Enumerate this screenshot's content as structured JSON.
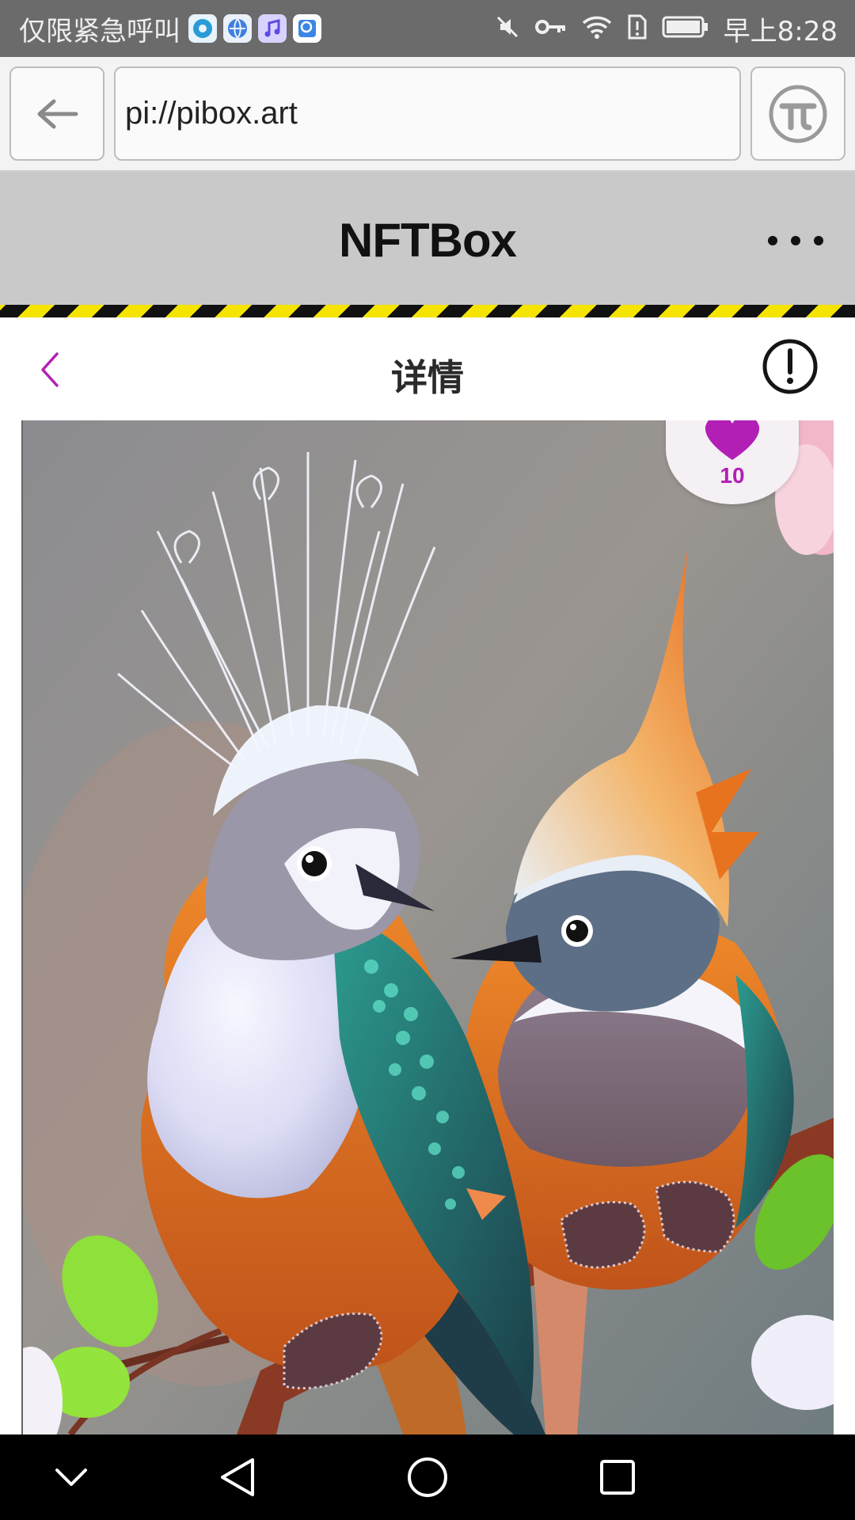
{
  "status_bar": {
    "carrier_text": "仅限紧急呼叫",
    "time": "早上8:28",
    "notification_icons": [
      "browser-app-icon",
      "globe-app-icon",
      "music-app-icon",
      "search-app-icon"
    ],
    "system_icons": [
      "mute-icon",
      "key-icon",
      "wifi-icon",
      "sim-alert-icon",
      "battery-icon"
    ]
  },
  "browser": {
    "url": "pi://pibox.art",
    "back_icon": "arrow-left-icon",
    "pi_icon": "pi-logo-icon"
  },
  "app_header": {
    "title": "NFTBox",
    "menu_icon": "more-dots-icon"
  },
  "detail": {
    "title": "详情",
    "back_icon": "chevron-left-icon",
    "info_icon": "info-circle-icon"
  },
  "artwork": {
    "likes": "10",
    "like_icon": "heart-icon"
  },
  "system_nav": {
    "buttons": [
      "collapse-icon",
      "back-triangle-icon",
      "home-circle-icon",
      "recents-square-icon"
    ]
  },
  "colors": {
    "status_bar": "#6b6b6b",
    "header_bg": "#c9c9c9",
    "accent_purple": "#b21fb5",
    "hazard_yellow": "#f5e300"
  }
}
